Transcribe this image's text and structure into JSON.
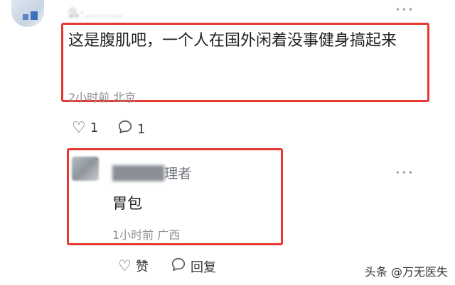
{
  "comment": {
    "username": "么·………",
    "text": "这是腹肌吧，一个人在国外闲着没事健身搞起来",
    "meta": "2小时前 北京",
    "like_count": "1",
    "reply_count": "1",
    "more_label": "···"
  },
  "reply": {
    "username_blurred": "█████",
    "username_suffix": "理者",
    "text": "胃包",
    "meta": "1小时前 广西",
    "like_label": "赞",
    "reply_label": "回复",
    "more_label": "···"
  },
  "watermark": "头条 @万无医失",
  "colors": {
    "highlight_border": "#e8382f",
    "meta_gray": "#8f8f8f"
  },
  "icons": {
    "like": "heart-outline-icon",
    "reply": "speech-bubble-icon",
    "more": "more-dots-icon"
  }
}
